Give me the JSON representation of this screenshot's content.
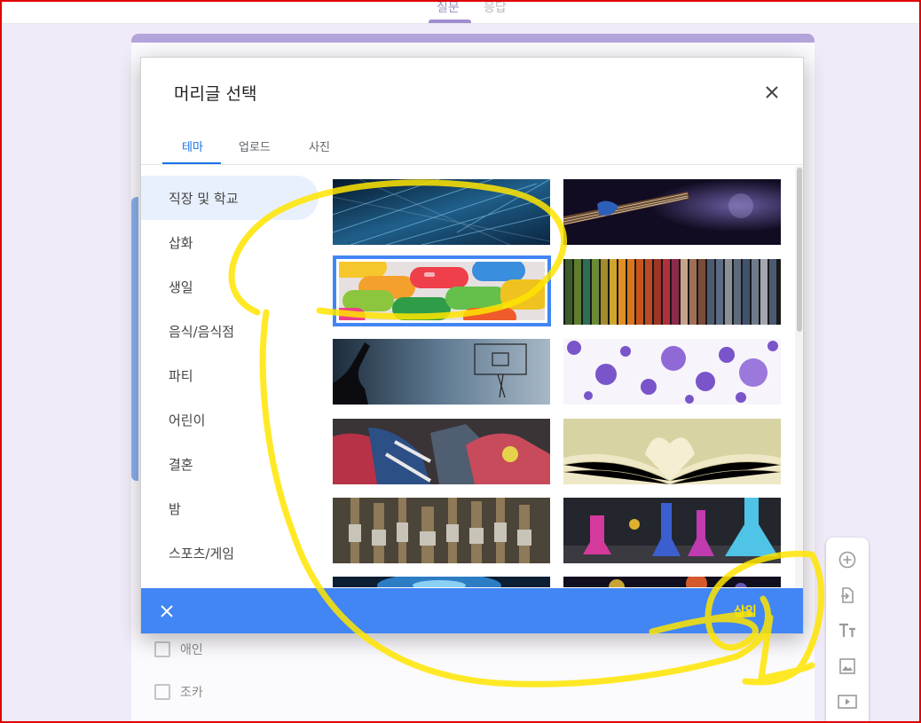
{
  "top_tabs": [
    {
      "label": "질문"
    },
    {
      "label": "응답"
    }
  ],
  "dialog": {
    "title": "머리글 선택",
    "tabs": [
      {
        "label": "테마"
      },
      {
        "label": "업로드"
      },
      {
        "label": "사진"
      }
    ],
    "categories": [
      {
        "label": "직장 및 학교"
      },
      {
        "label": "삽화"
      },
      {
        "label": "생일"
      },
      {
        "label": "음식/음식점"
      },
      {
        "label": "파티"
      },
      {
        "label": "어린이"
      },
      {
        "label": "결혼"
      },
      {
        "label": "밤"
      },
      {
        "label": "스포츠/게임"
      }
    ],
    "insert_label": "삽입",
    "close_icon": "close-icon"
  },
  "form": {
    "options": [
      {
        "label": "애인"
      },
      {
        "label": "조카"
      }
    ]
  },
  "theme": {
    "accent": "#4285f4",
    "form_accent": "#b4a4dc",
    "highlight_annotation": "#ffe500"
  }
}
